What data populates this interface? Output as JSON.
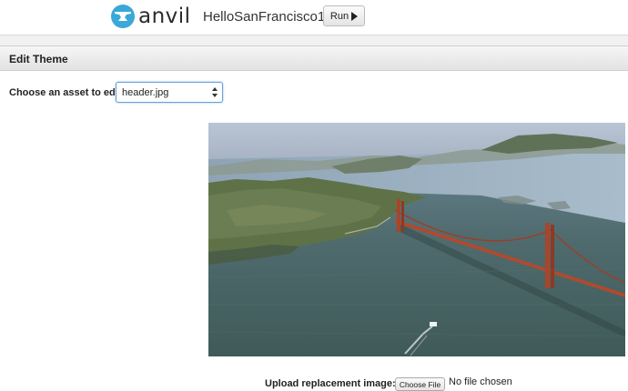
{
  "header": {
    "logo_text": "anvil",
    "app_name": "HelloSanFrancisco1",
    "run_label": "Run"
  },
  "section": {
    "title": "Edit Theme"
  },
  "asset": {
    "label": "Choose an asset to edit:",
    "selected": "header.jpg"
  },
  "upload": {
    "label": "Upload replacement image:",
    "button_label": "Choose File",
    "status": "No file chosen"
  },
  "colors": {
    "brand": "#3aa8d8",
    "select_focus": "#6aa0d8"
  },
  "icons": {
    "logo": "anvil-logo-icon",
    "run": "play-icon",
    "select": "select-arrows-icon"
  }
}
